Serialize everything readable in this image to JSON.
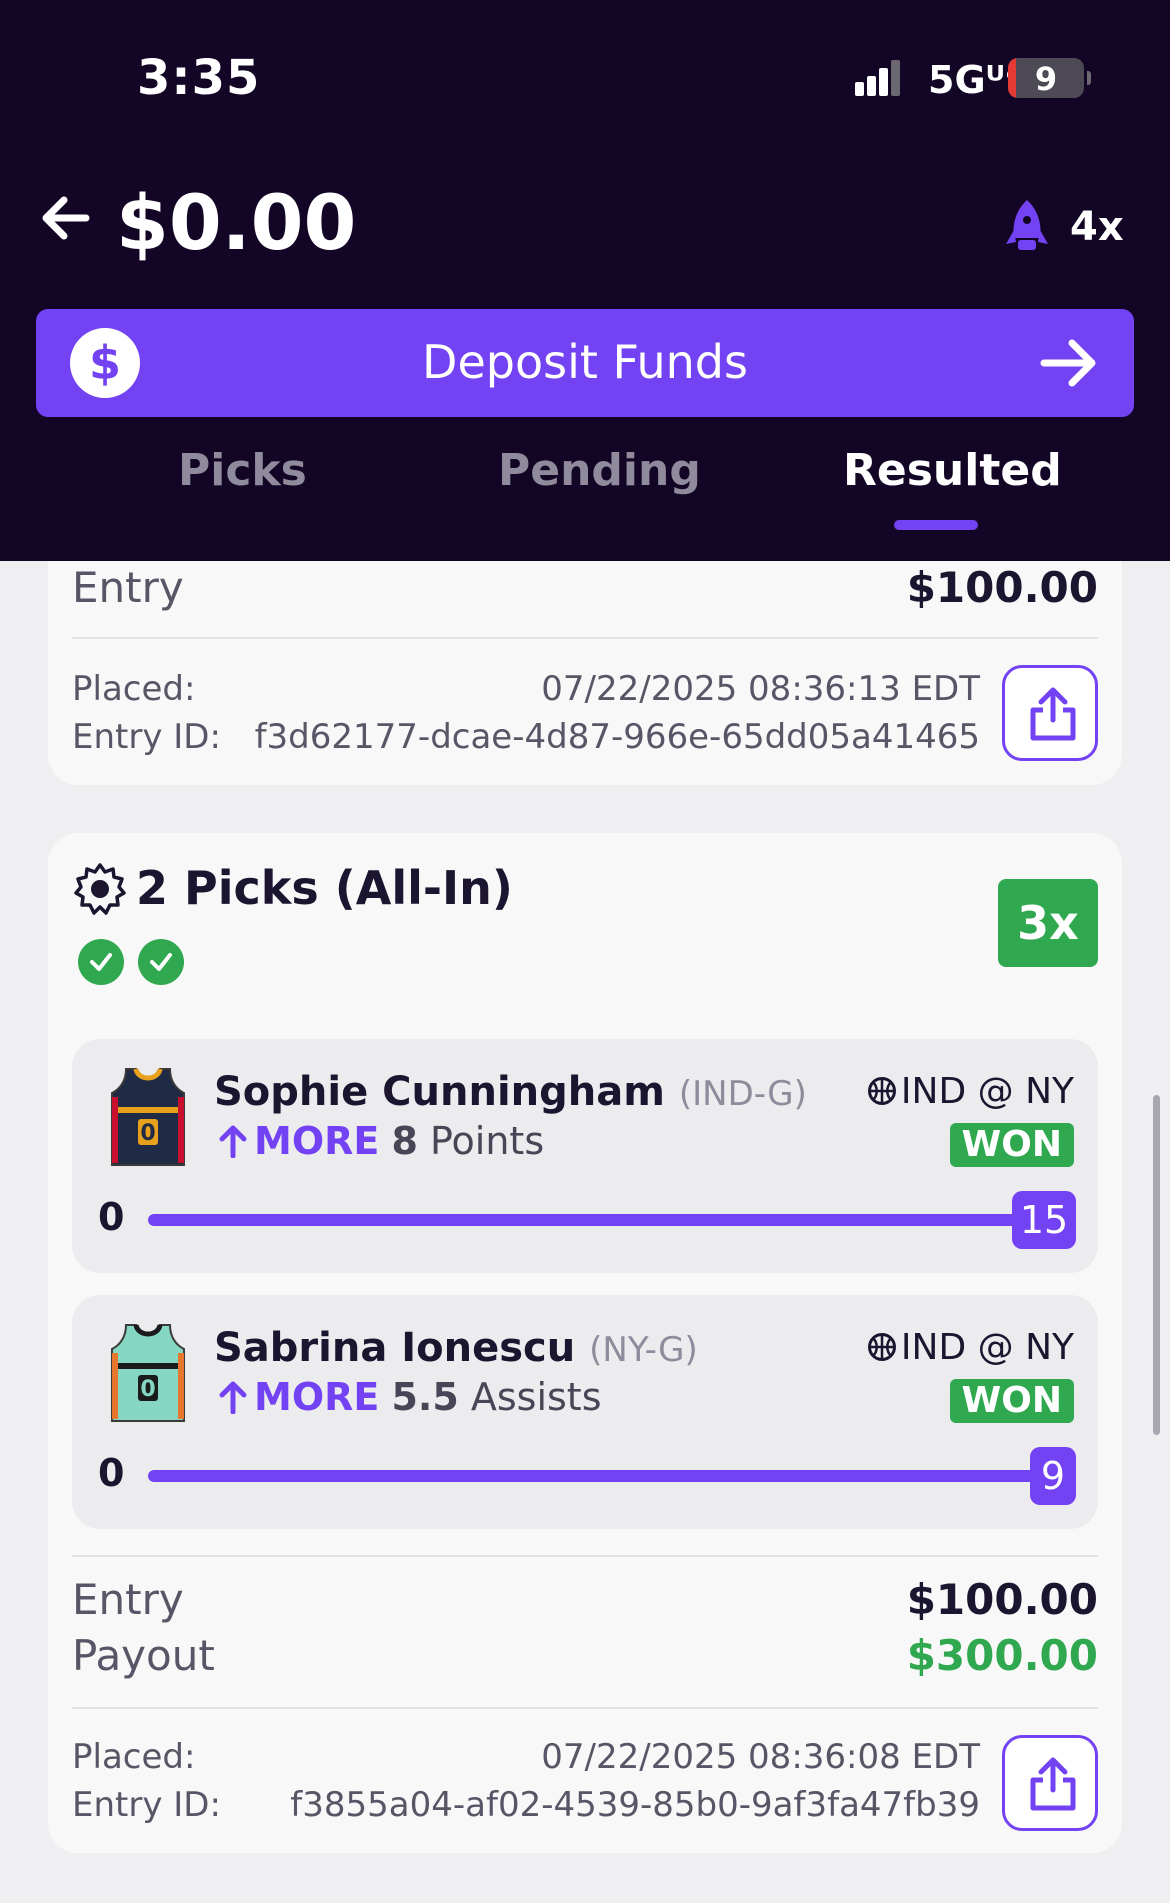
{
  "status_bar": {
    "time": "3:35",
    "network": "5Gᵁᶜ",
    "battery": "9"
  },
  "header": {
    "balance": "$0.00",
    "boost_label": "4x"
  },
  "deposit": {
    "label": "Deposit Funds",
    "icon": "dollar-coin-icon"
  },
  "tabs": [
    {
      "label": "Picks",
      "active": false
    },
    {
      "label": "Pending",
      "active": false
    },
    {
      "label": "Resulted",
      "active": true
    }
  ],
  "prev_entry": {
    "entry_label": "Entry",
    "entry_value": "$100.00",
    "placed_label": "Placed:",
    "placed_value": "07/22/2025 08:36:13 EDT",
    "id_label": "Entry ID:",
    "id_value": "f3d62177-dcae-4d87-966e-65dd05a41465"
  },
  "entry": {
    "title": "2 Picks (All-In)",
    "multiplier": "3x",
    "picks": [
      {
        "player": "Sophie Cunningham",
        "position": "(IND-G)",
        "direction": "MORE",
        "line": "8",
        "stat": "Points",
        "matchup": "IND @ NY",
        "result": "WON",
        "bar_min": "0",
        "bar_value": "15",
        "jersey_color": "#1f2a44"
      },
      {
        "player": "Sabrina Ionescu",
        "position": "(NY-G)",
        "direction": "MORE",
        "line": "5.5",
        "stat": "Assists",
        "matchup": "IND @ NY",
        "result": "WON",
        "bar_min": "0",
        "bar_value": "9",
        "jersey_color": "#86d6c4"
      }
    ],
    "entry_label": "Entry",
    "entry_value": "$100.00",
    "payout_label": "Payout",
    "payout_value": "$300.00",
    "placed_label": "Placed:",
    "placed_value": "07/22/2025 08:36:08 EDT",
    "id_label": "Entry ID:",
    "id_value": "f3855a04-af02-4539-85b0-9af3fa47fb39"
  },
  "colors": {
    "header_bg": "#130525",
    "accent": "#7342f3",
    "win_green": "#2fa84f"
  }
}
